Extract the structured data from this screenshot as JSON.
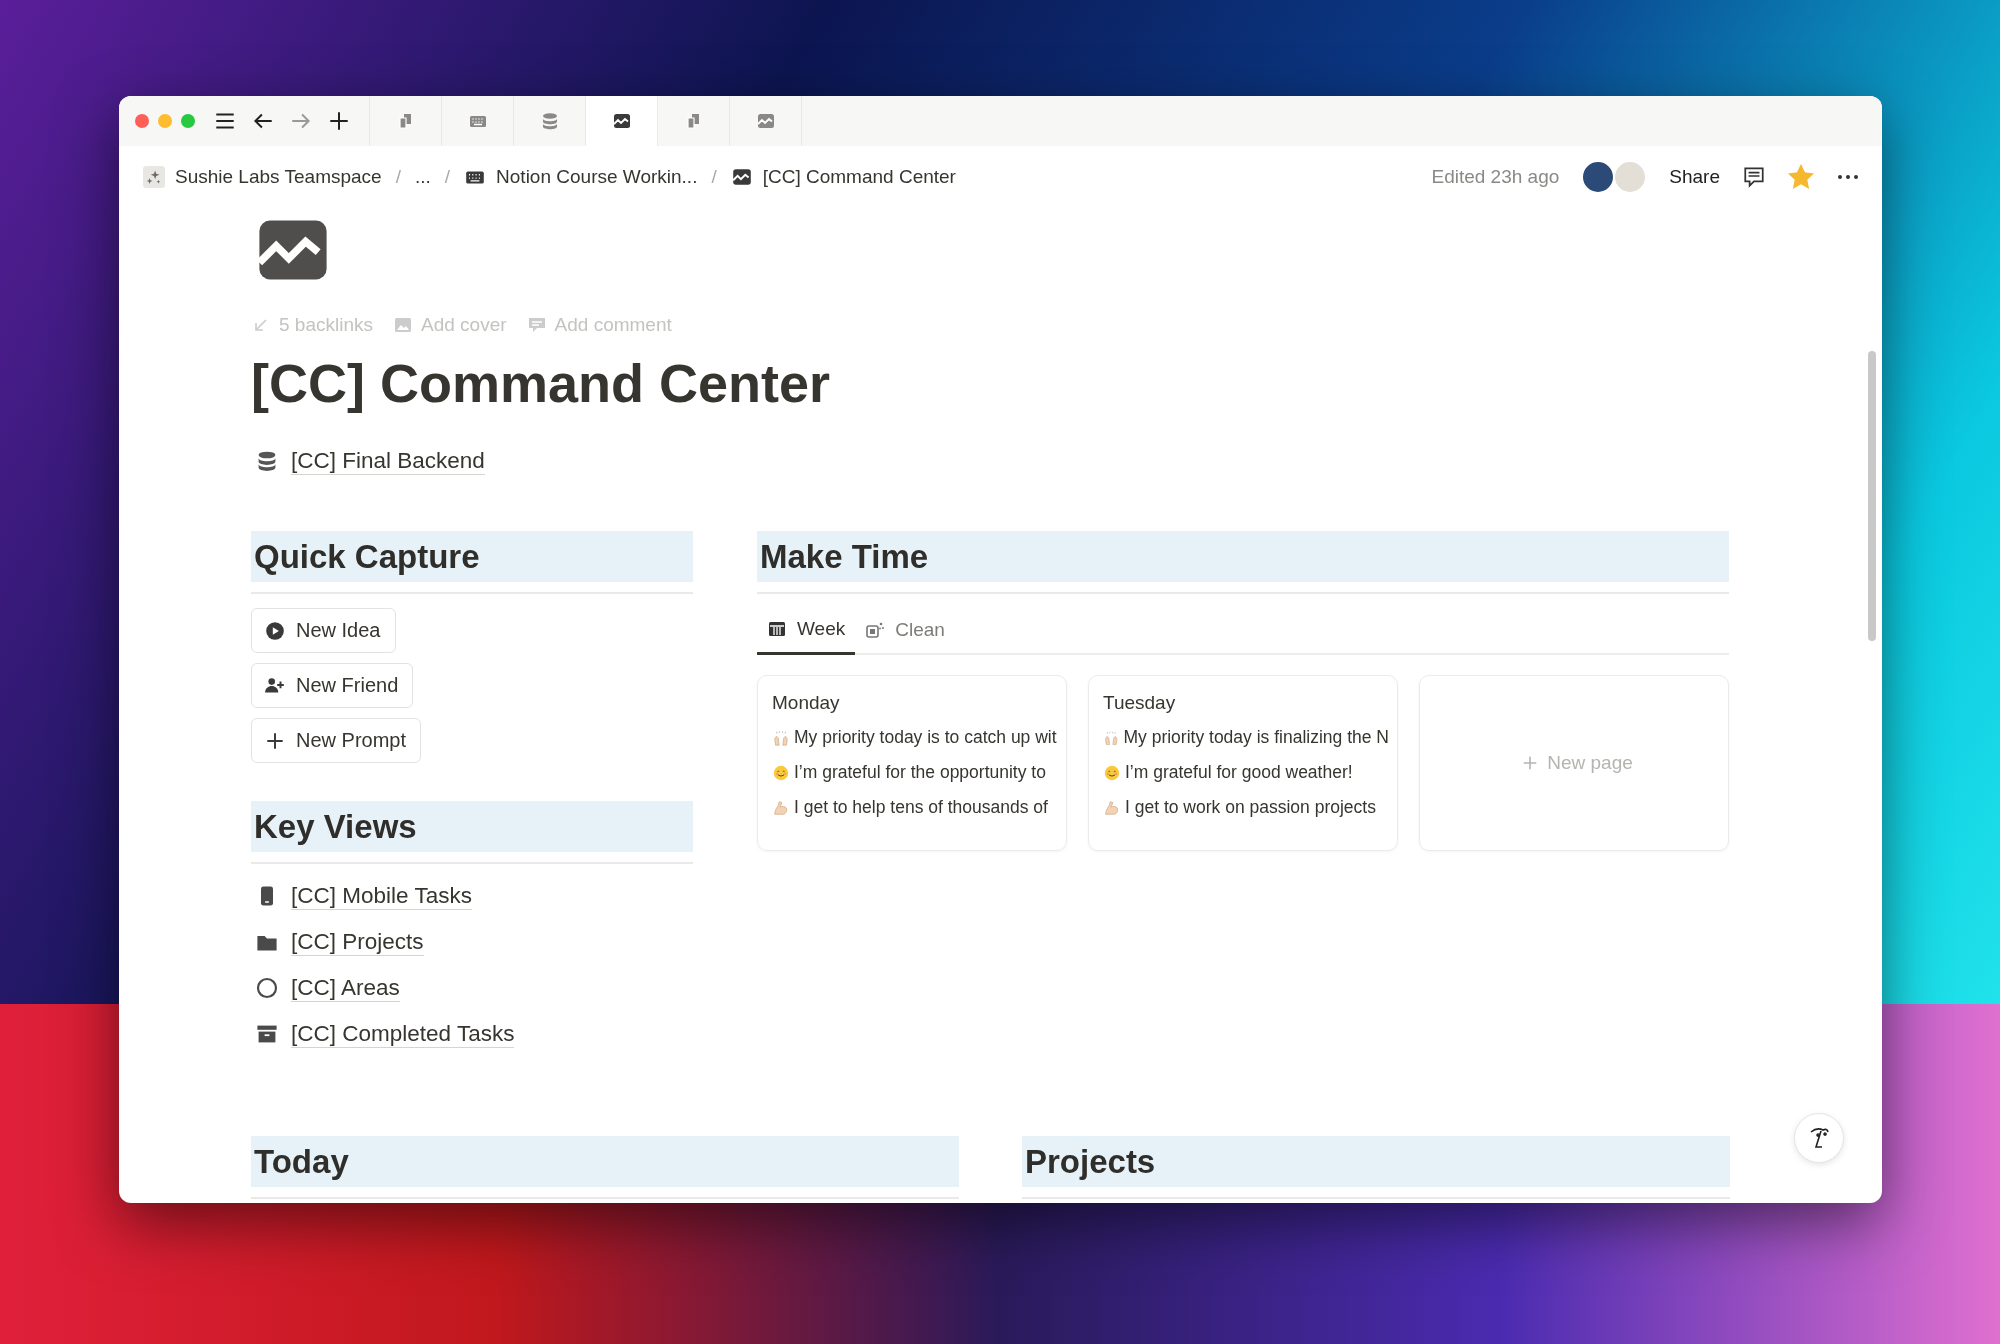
{
  "tabs": [
    {
      "kind": "pages",
      "selected": false
    },
    {
      "kind": "keyboard",
      "selected": false
    },
    {
      "kind": "database",
      "selected": false
    },
    {
      "kind": "chart",
      "selected": true
    },
    {
      "kind": "pages",
      "selected": false
    },
    {
      "kind": "chart",
      "selected": false
    }
  ],
  "breadcrumb": [
    {
      "kind": "sparkle",
      "label": "Sushie Labs Teamspace"
    },
    {
      "kind": "separator",
      "label": "/"
    },
    {
      "kind": "plain",
      "label": "..."
    },
    {
      "kind": "separator",
      "label": "/"
    },
    {
      "kind": "keyboard",
      "label": "Notion Course Workin..."
    },
    {
      "kind": "separator",
      "label": "/"
    },
    {
      "kind": "chart",
      "label": "[CC] Command Center"
    }
  ],
  "topbar": {
    "edited": "Edited 23h ago",
    "share": "Share",
    "favorite": true
  },
  "page": {
    "backlinks": "5 backlinks",
    "add_cover": "Add cover",
    "add_comment": "Add comment",
    "title": "[CC] Command Center",
    "backend_link": "[CC] Final Backend"
  },
  "quick_capture": {
    "heading": "Quick Capture",
    "buttons": [
      {
        "kind": "play",
        "label": "New Idea"
      },
      {
        "kind": "add-person",
        "label": "New Friend"
      },
      {
        "kind": "plus",
        "label": "New Prompt"
      }
    ]
  },
  "key_views": {
    "heading": "Key Views",
    "links": [
      {
        "kind": "phone",
        "label": "[CC] Mobile Tasks"
      },
      {
        "kind": "folder",
        "label": "[CC] Projects"
      },
      {
        "kind": "circle",
        "label": "[CC] Areas"
      },
      {
        "kind": "archive",
        "label": "[CC] Completed Tasks"
      }
    ]
  },
  "make_time": {
    "heading": "Make Time",
    "views": [
      {
        "kind": "calendar",
        "label": "Week",
        "selected": true
      },
      {
        "kind": "clean",
        "label": "Clean",
        "selected": false
      }
    ],
    "cards": [
      {
        "title": "Monday",
        "lines": [
          {
            "kind": "hands",
            "text": "My priority today is to catch up wit"
          },
          {
            "kind": "smile",
            "text": "I’m grateful for the opportunity to"
          },
          {
            "kind": "arm",
            "text": "I get to help tens of thousands of"
          }
        ]
      },
      {
        "title": "Tuesday",
        "lines": [
          {
            "kind": "hands",
            "text": "My priority today is finalizing the N"
          },
          {
            "kind": "smile",
            "text": "I’m grateful for good weather!"
          },
          {
            "kind": "arm",
            "text": "I get to work on passion projects"
          }
        ]
      }
    ],
    "new_page": "New page"
  },
  "bottom_sections": [
    {
      "heading": "Today"
    },
    {
      "heading": "Projects"
    }
  ]
}
